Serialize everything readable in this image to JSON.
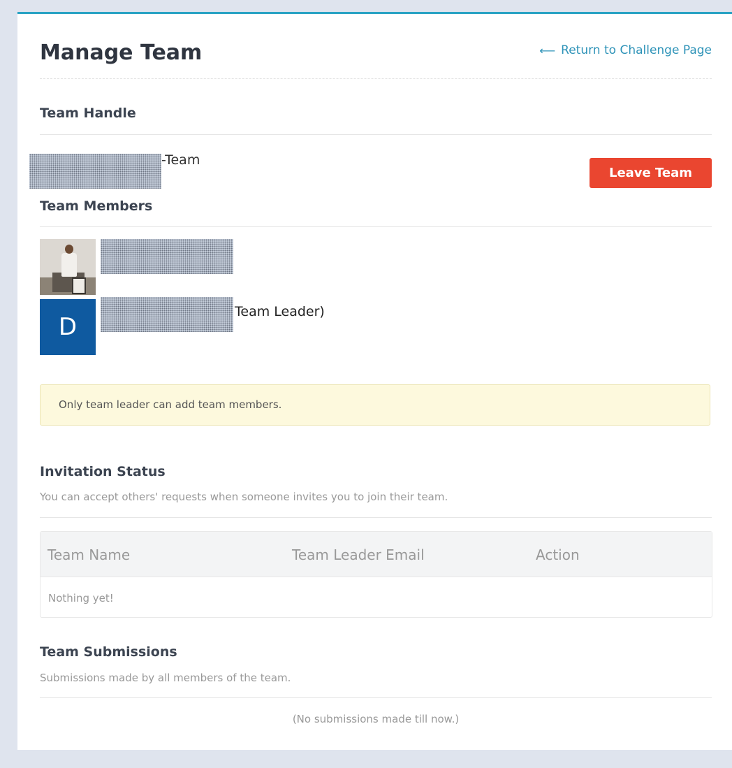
{
  "header": {
    "title": "Manage Team",
    "return_link": "Return to Challenge Page",
    "return_icon": "left-arrow-icon"
  },
  "team_handle": {
    "heading": "Team Handle",
    "suffix": "-Team",
    "leave_button": "Leave Team"
  },
  "members": {
    "heading": "Team Members",
    "list": [
      {
        "avatar_type": "photo",
        "note": ""
      },
      {
        "avatar_type": "initial",
        "initial": "D",
        "note": "Team Leader)"
      }
    ]
  },
  "alert": {
    "text": "Only team leader can add team members."
  },
  "invitations": {
    "heading": "Invitation Status",
    "subtext": "You can accept others' requests when someone invites you to join their team.",
    "columns": [
      "Team Name",
      "Team Leader Email",
      "Action"
    ],
    "empty": "Nothing yet!"
  },
  "submissions": {
    "heading": "Team Submissions",
    "subtext": "Submissions made by all members of the team.",
    "empty": "(No submissions made till now.)"
  },
  "colors": {
    "accent": "#29a3c4",
    "link": "#2e93b8",
    "danger": "#ea4630",
    "avatar_blue": "#0f5aa0",
    "alert_bg": "#fdf9dd"
  }
}
